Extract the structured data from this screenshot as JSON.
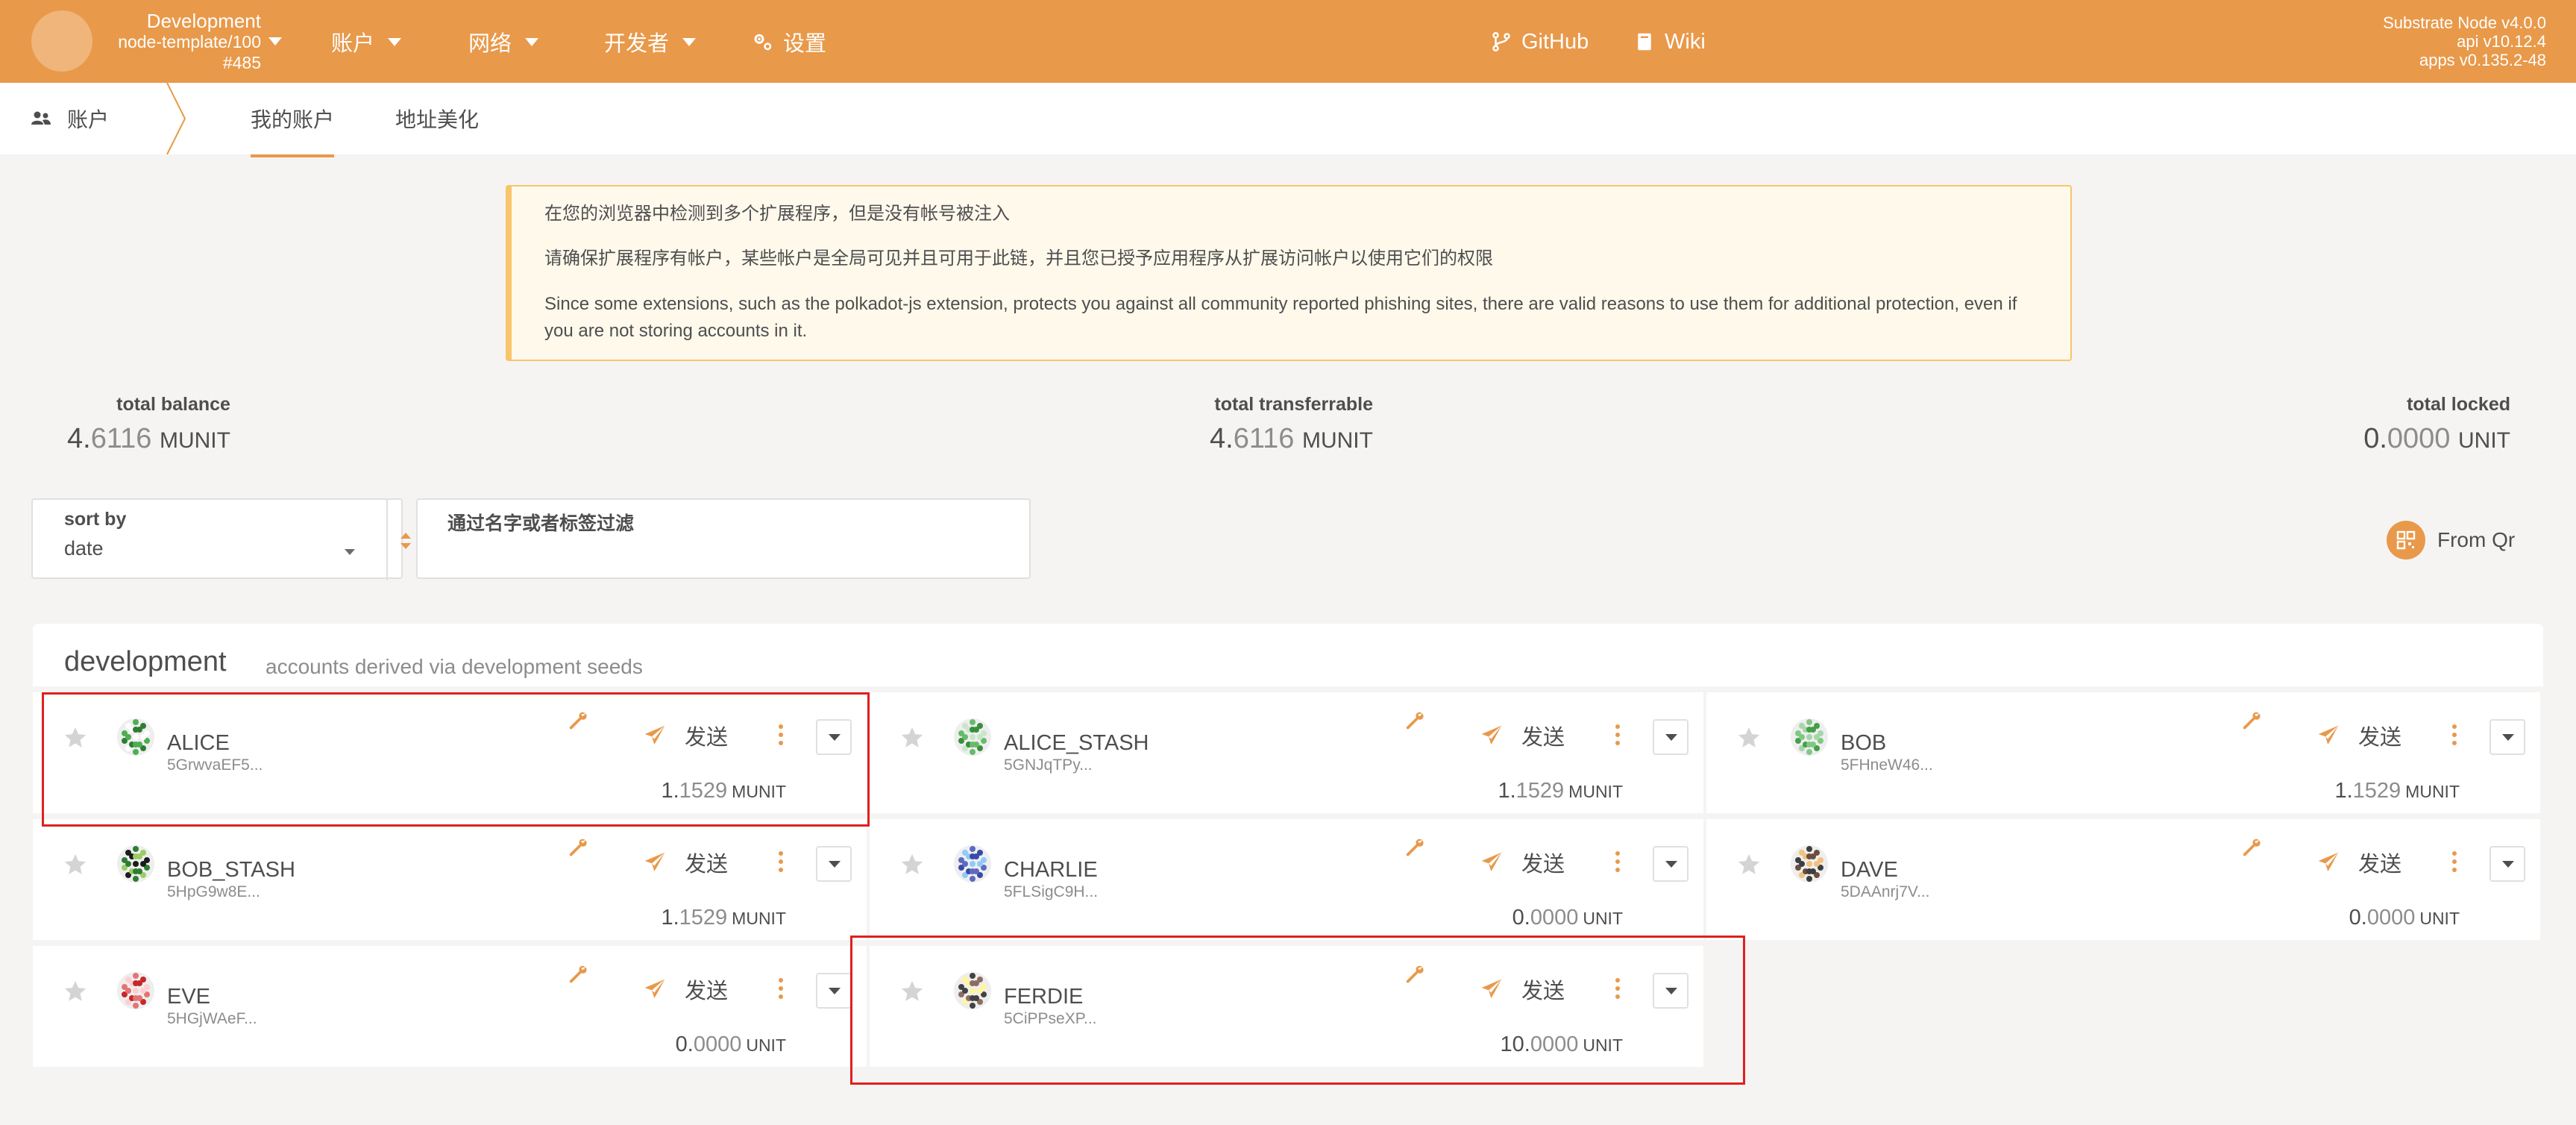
{
  "header": {
    "chain_name": "Development",
    "chain_spec": "node-template/100",
    "block": "#485",
    "nav": [
      {
        "label": "账户",
        "has_caret": true
      },
      {
        "label": "网络",
        "has_caret": true
      },
      {
        "label": "开发者",
        "has_caret": true
      },
      {
        "label": "设置",
        "has_caret": false
      }
    ],
    "links": [
      {
        "label": "GitHub",
        "icon": "git-branch-icon"
      },
      {
        "label": "Wiki",
        "icon": "book-icon"
      }
    ],
    "version_lines": [
      "Substrate Node v4.0.0",
      "api v10.12.4",
      "apps v0.135.2-48"
    ]
  },
  "subnav": {
    "section": "账户",
    "tabs": [
      "我的账户",
      "地址美化"
    ],
    "active_tab": 0
  },
  "warning": {
    "lines": [
      "在您的浏览器中检测到多个扩展程序，但是没有帐号被注入",
      "请确保扩展程序有帐户，某些帐户是全局可见并且可用于此链，并且您已授予应用程序从扩展访问帐户以使用它们的权限",
      "Since some extensions, such as the polkadot-js extension, protects you against all community reported phishing sites, there are valid reasons to use them for additional protection, even if you are not storing accounts in it."
    ]
  },
  "summary": {
    "total_balance": {
      "label": "total balance",
      "int": "4.",
      "dec": "6116",
      "unit": "MUNIT"
    },
    "total_transferrable": {
      "label": "total transferrable",
      "int": "4.",
      "dec": "6116",
      "unit": "MUNIT"
    },
    "total_locked": {
      "label": "total locked",
      "int": "0.",
      "dec": "0000",
      "unit": "UNIT"
    }
  },
  "controls": {
    "sort_label": "sort by",
    "sort_value": "date",
    "filter_label": "通过名字或者标签过滤",
    "filter_value": "",
    "from_qr": "From Qr"
  },
  "group": {
    "title": "development",
    "subtitle": "accounts derived via development seeds"
  },
  "accounts": [
    {
      "name": "ALICE",
      "address": "5GrwvaEF5...",
      "send": "发送",
      "int": "1.",
      "dec": "1529",
      "unit": "MUNIT"
    },
    {
      "name": "ALICE_STASH",
      "address": "5GNJqTPy...",
      "send": "发送",
      "int": "1.",
      "dec": "1529",
      "unit": "MUNIT"
    },
    {
      "name": "BOB",
      "address": "5FHneW46...",
      "send": "发送",
      "int": "1.",
      "dec": "1529",
      "unit": "MUNIT"
    },
    {
      "name": "BOB_STASH",
      "address": "5HpG9w8E...",
      "send": "发送",
      "int": "1.",
      "dec": "1529",
      "unit": "MUNIT"
    },
    {
      "name": "CHARLIE",
      "address": "5FLSigC9H...",
      "send": "发送",
      "int": "0.",
      "dec": "0000",
      "unit": "UNIT"
    },
    {
      "name": "DAVE",
      "address": "5DAAnrj7V...",
      "send": "发送",
      "int": "0.",
      "dec": "0000",
      "unit": "UNIT"
    },
    {
      "name": "EVE",
      "address": "5HGjWAeF...",
      "send": "发送",
      "int": "0.",
      "dec": "0000",
      "unit": "UNIT"
    },
    {
      "name": "FERDIE",
      "address": "5CiPPseXP...",
      "send": "发送",
      "int": "10.",
      "dec": "0000",
      "unit": "UNIT"
    }
  ],
  "colors": {
    "accent": "#e8994a",
    "highlight": "#e02020",
    "warning_border": "#f7c56a"
  }
}
